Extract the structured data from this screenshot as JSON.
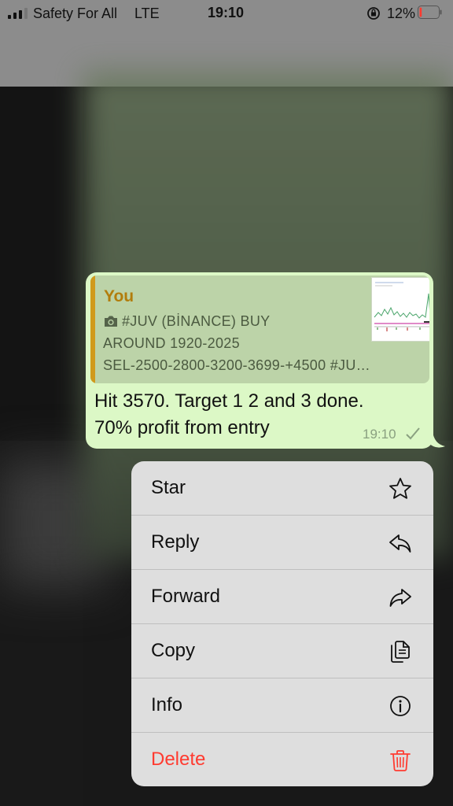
{
  "status_bar": {
    "carrier": "Safety For All",
    "network": "LTE",
    "time": "19:10",
    "battery": "12%",
    "battery_level": 0.12
  },
  "message": {
    "quote": {
      "sender": "You",
      "line1": "#JUV (BİNANCE)  BUY",
      "line2": "AROUND 1920-2025",
      "line3": "SEL-2500-2800-3200-3699-+4500  #JU…"
    },
    "text_line1": "Hit 3570. Target 1 2 and 3 done.",
    "text_line2": "70% profit from entry",
    "time": "19:10"
  },
  "menu": {
    "star": "Star",
    "reply": "Reply",
    "forward": "Forward",
    "copy": "Copy",
    "info": "Info",
    "delete": "Delete"
  },
  "colors": {
    "bubble": "#dcf8c6",
    "quote_bar": "#d09a1c",
    "danger": "#ff3b30"
  }
}
